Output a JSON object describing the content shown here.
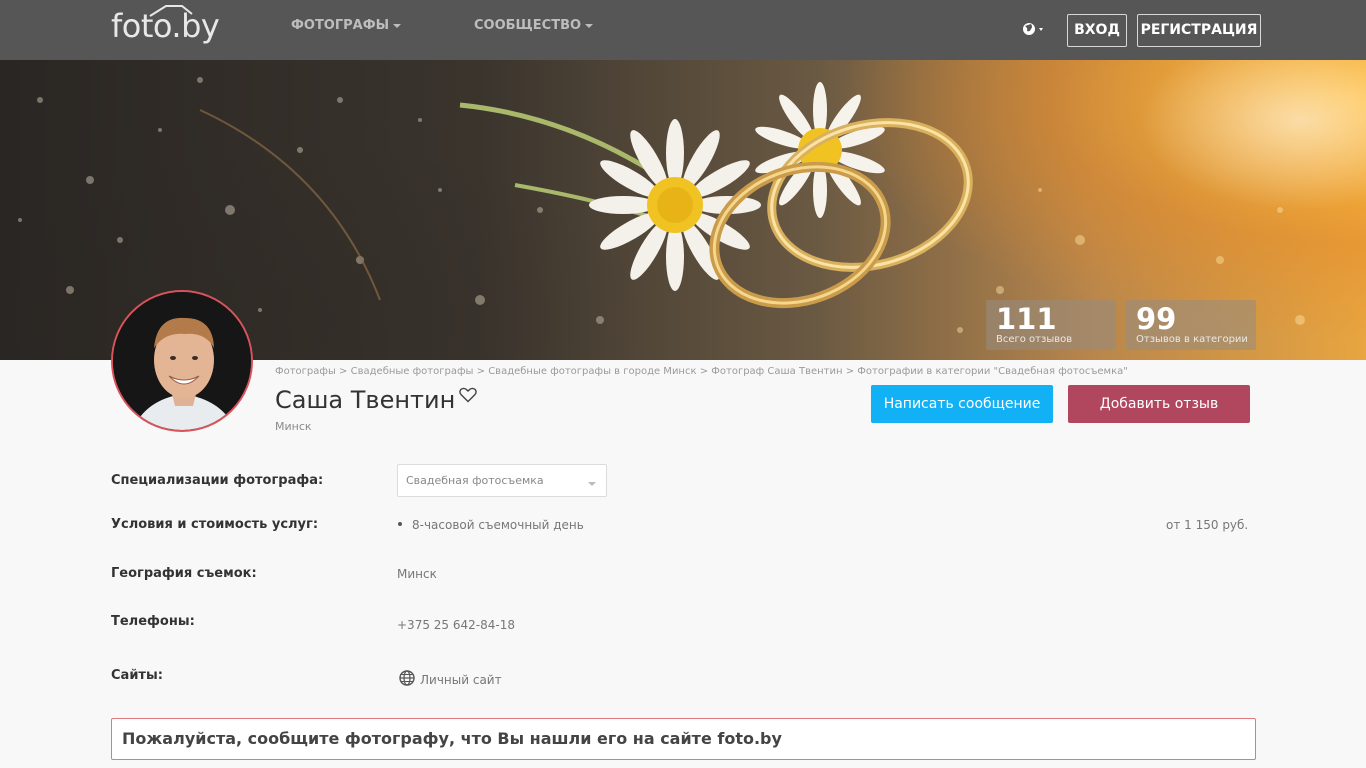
{
  "header": {
    "logo": "foto.by",
    "nav": [
      "Фотографы",
      "Сообщество"
    ],
    "login": "ВХОД",
    "register": "РЕГИСТРАЦИЯ"
  },
  "stats": [
    {
      "value": "111",
      "label": "Всего отзывов"
    },
    {
      "value": "99",
      "label": "Отзывов в категории"
    }
  ],
  "breadcrumb": [
    "Фотографы",
    "Свадебные фотографы",
    "Свадебные фотографы в городе Минск",
    "Фотограф Саша Твентин",
    "Фотографии в категории \"Свадебная фотосъемка\""
  ],
  "breadcrumb_separator": ">",
  "profile": {
    "name": "Саша Твентин",
    "city": "Минск",
    "message_button": "Написать сообщение",
    "review_button": "Добавить отзыв"
  },
  "info": {
    "specialization_label": "Специализации фотографа:",
    "specialization_value": "Свадебная фотосъемка",
    "services_label": "Условия и стоимость услуг:",
    "service_name": "8-часовой съемочный день",
    "service_price": "от 1 150 руб.",
    "geography_label": "География съемок:",
    "geography_value": "Минск",
    "phones_label": "Телефоны:",
    "phone": "+375 25 642-84-18",
    "sites_label": "Сайты:",
    "site_link": "Личный сайт"
  },
  "notice": "Пожалуйста, сообщите фотографу, что Вы нашли его на сайте foto.by",
  "colors": {
    "topbar": "#565656",
    "primary_button": "#12b0f5",
    "review_button": "#b1475f",
    "notice_border": "#e07a7a"
  }
}
